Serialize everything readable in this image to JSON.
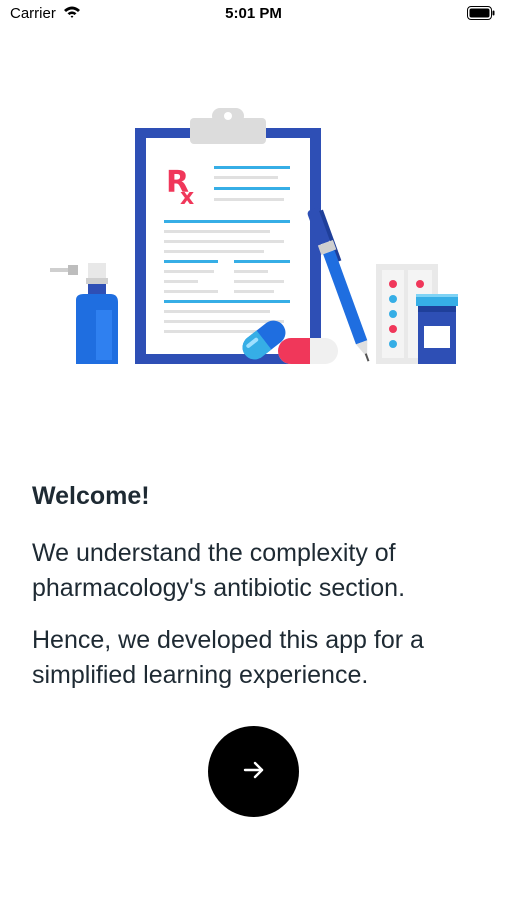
{
  "status_bar": {
    "carrier": "Carrier",
    "time": "5:01 PM",
    "wifi_icon": "wifi-icon",
    "battery_icon": "battery-icon"
  },
  "illustration": {
    "name": "prescription-clipboard-illustration",
    "clipboard_symbol": "Rx",
    "colors": {
      "blue": "#2e4fb5",
      "light_blue": "#36aee6",
      "red": "#f0375a",
      "grey": "#e6e6e6"
    }
  },
  "welcome": {
    "title": "Welcome!",
    "paragraph_1": "We understand the complexity of pharmacology's antibiotic section.",
    "paragraph_2": "Hence, we developed this app for a simplified learning experience."
  },
  "next_button": {
    "icon": "arrow-right-icon",
    "background": "#000000"
  }
}
